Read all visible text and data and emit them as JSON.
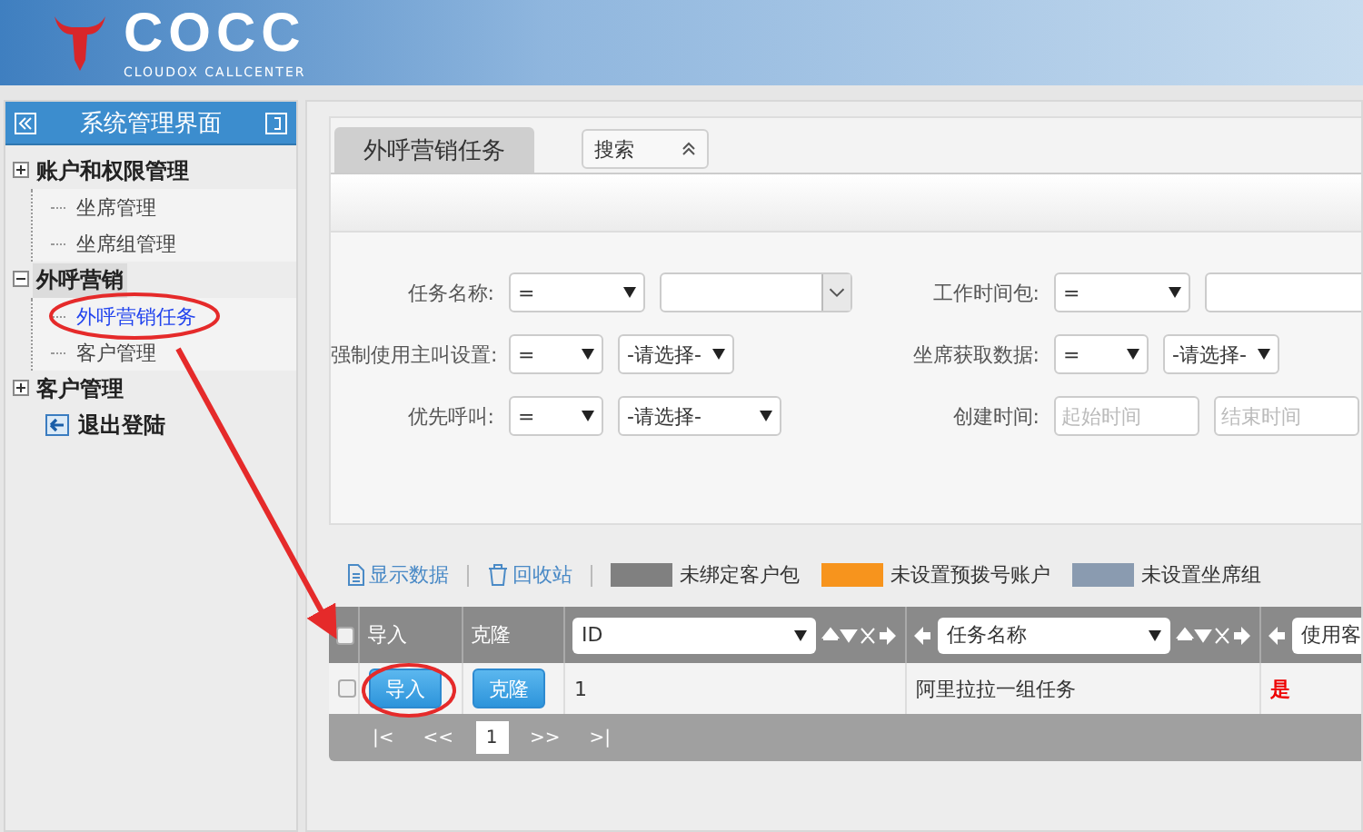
{
  "header": {
    "logo_text": "COCC",
    "logo_subtitle": "CLOUDOX CALLCENTER"
  },
  "sidebar": {
    "title": "系统管理界面",
    "items": [
      {
        "kind": "group",
        "label": "账户和权限管理",
        "expanded": false,
        "selected": false,
        "children": [
          {
            "label": "坐席管理",
            "selected": false
          },
          {
            "label": "坐席组管理",
            "selected": false
          }
        ]
      },
      {
        "kind": "group",
        "label": "外呼营销",
        "expanded": true,
        "selected": true,
        "children": [
          {
            "label": "外呼营销任务",
            "selected": true
          },
          {
            "label": "客户管理",
            "selected": false
          }
        ]
      },
      {
        "kind": "group",
        "label": "客户管理",
        "expanded": false,
        "selected": false
      },
      {
        "kind": "exit",
        "label": "退出登陆",
        "selected": false
      }
    ]
  },
  "main": {
    "tabs": [
      {
        "label": "外呼营销任务",
        "selected": true
      }
    ],
    "search_toggle": {
      "label": "搜索",
      "expanded": true
    },
    "filters": [
      {
        "label": "任务名称:",
        "operator": "=",
        "kind": "combo"
      },
      {
        "label": "工作时间包:",
        "operator": "=",
        "kind": "text"
      },
      {
        "label": "强制使用主叫设置:",
        "operator": "=",
        "kind": "select",
        "value": "-请选择-"
      },
      {
        "label": "坐席获取数据:",
        "operator": "=",
        "kind": "select",
        "value": "-请选择-"
      },
      {
        "label": "优先呼叫:",
        "operator": "=",
        "kind": "select",
        "value": "-请选择-"
      },
      {
        "label": "创建时间:",
        "kind": "daterange",
        "start_placeholder": "起始时间",
        "end_placeholder": "结束时间"
      }
    ],
    "toolbar": {
      "links": [
        {
          "kind": "document",
          "label": "显示数据"
        },
        {
          "kind": "trash",
          "label": "回收站"
        }
      ],
      "legend": [
        {
          "label": "未绑定客户包",
          "color": "#808080"
        },
        {
          "label": "未设置预拨号账户",
          "color": "#f7941d"
        },
        {
          "label": "未设置坐席组",
          "color": "#8a9bb0"
        }
      ]
    },
    "table": {
      "select_all": {
        "checked": false
      },
      "columns": [
        {
          "kind": "plain",
          "label": "导入"
        },
        {
          "kind": "plain",
          "label": "克隆"
        },
        {
          "kind": "picker",
          "label": "ID"
        },
        {
          "kind": "picker",
          "label": "任务名称"
        },
        {
          "kind": "picker",
          "label": "使用客"
        }
      ],
      "rows": [
        {
          "checked": false,
          "cells": [
            {
              "kind": "button",
              "text": "导入"
            },
            {
              "kind": "button",
              "text": "克隆"
            },
            {
              "kind": "text",
              "text": "1"
            },
            {
              "kind": "text",
              "text": "阿里拉拉一组任务"
            },
            {
              "kind": "alert",
              "text": "是"
            }
          ]
        }
      ],
      "pagination": {
        "first": "|<",
        "prev": "<<",
        "pages": [
          {
            "label": "1",
            "selected": true
          }
        ],
        "next": ">>",
        "last": ">|"
      }
    }
  },
  "annotations": [
    {
      "kind": "circle"
    },
    {
      "kind": "circle"
    },
    {
      "kind": "arrow"
    }
  ]
}
